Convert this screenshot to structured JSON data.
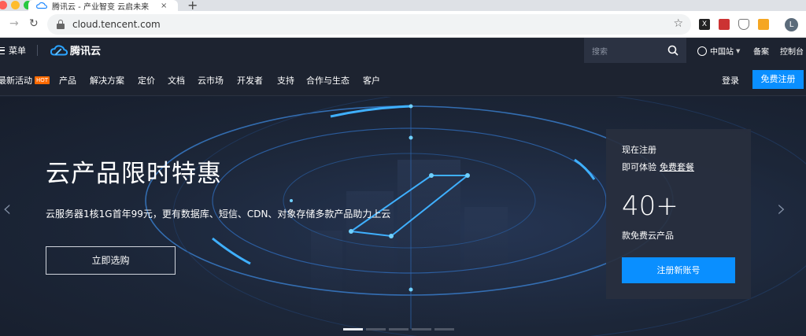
{
  "browser": {
    "tab_title": "腾讯云 - 产业智变 云启未来",
    "tab_close": "×",
    "new_tab": "+",
    "url": "cloud.tencent.com",
    "ext_label": "X",
    "avatar_letter": "L"
  },
  "topbar": {
    "menu_label": "菜单",
    "logo_text": "腾讯云",
    "search_placeholder": "搜索",
    "region": "中国站",
    "links": [
      "备案",
      "控制台"
    ]
  },
  "nav": {
    "items": [
      "最新活动",
      "产品",
      "解决方案",
      "定价",
      "文档",
      "云市场",
      "开发者",
      "支持",
      "合作与生态",
      "客户"
    ],
    "hot_badge": "HOT",
    "login": "登录",
    "signup": "免费注册"
  },
  "hero": {
    "title": "云产品限时特惠",
    "subtitle": "云服务器1核1G首年99元，更有数据库、短信、CDN、对象存储多款产品助力上云",
    "cta": "立即选购",
    "slide_count": 5,
    "active_slide": 0
  },
  "promo": {
    "line1": "现在注册",
    "line2_prefix": "即可体验",
    "line2_link": "免费套餐",
    "count": "40+",
    "count_note": "款免费云产品",
    "button": "注册新账号"
  },
  "colors": {
    "accent": "#0a8fff",
    "hot": "#ff6a00",
    "bar_bg": "#1d2330"
  }
}
